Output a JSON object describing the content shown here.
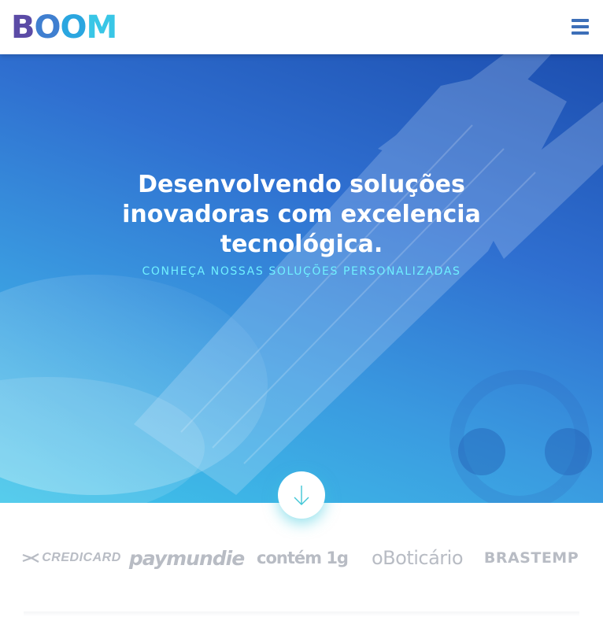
{
  "brand": {
    "logo_letters": [
      "B",
      "O",
      "O",
      "M"
    ],
    "logo_colors": [
      "#5b4ba6",
      "#3f7fd0",
      "#2aa6e0",
      "#39c6e6"
    ]
  },
  "header": {
    "menu_icon": "hamburger-menu-icon"
  },
  "hero": {
    "title_lines": [
      "Desenvolvendo soluções",
      "inovadoras com excelencia",
      "tecnológica."
    ],
    "subtitle": "CONHEÇA NOSSAS SOLUÇÕES PERSONALIZADAS",
    "scroll_icon": "arrow-down-icon",
    "colors": {
      "gradient_top": "#1d4fb0",
      "gradient_bottom": "#3fc6ea",
      "subtitle": "#6ff0ff"
    }
  },
  "clients": [
    {
      "name": "CREDICARD"
    },
    {
      "name": "paymundie"
    },
    {
      "name": "contém 1g"
    },
    {
      "name": "oBoticário"
    },
    {
      "name": "BRASTEMP"
    }
  ]
}
